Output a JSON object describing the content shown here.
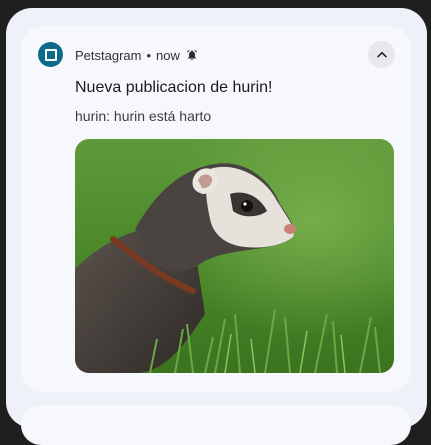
{
  "notification": {
    "app_name": "Petstagram",
    "separator": "•",
    "time": "now",
    "title": "Nueva publicacion de hurin!",
    "body": "hurin: hurin está harto",
    "image_subject": "ferret-photo"
  },
  "icons": {
    "app": "petstagram-app-icon",
    "alert": "bell-icon",
    "expand": "chevron-up-icon"
  },
  "colors": {
    "app_icon": "#0d6b8a",
    "card": "#f7f8fc",
    "shade": "#eef1f7"
  }
}
